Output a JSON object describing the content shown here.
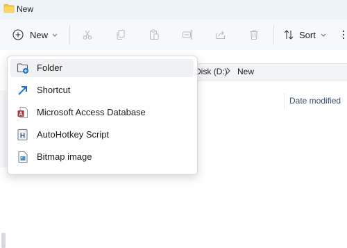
{
  "window": {
    "title": "New"
  },
  "toolbar": {
    "new_label": "New",
    "sort_label": "Sort",
    "icons": [
      "plus-circle-icon",
      "cut-icon",
      "copy-icon",
      "paste-icon",
      "rename-icon",
      "share-icon",
      "delete-icon",
      "sort-icon",
      "more-icon"
    ]
  },
  "address": {
    "crumbs": [
      "Disk (D:)",
      "New"
    ],
    "crumb_visible": "Disk (D:)"
  },
  "columns": {
    "date_modified": "Date modified"
  },
  "menu": {
    "items": [
      {
        "label": "Folder",
        "icon": "new-folder-icon",
        "selected": true
      },
      {
        "label": "Shortcut",
        "icon": "shortcut-icon",
        "selected": false
      },
      {
        "label": "Microsoft Access Database",
        "icon": "access-icon",
        "selected": false
      },
      {
        "label": "AutoHotkey Script",
        "icon": "autohotkey-icon",
        "selected": false
      },
      {
        "label": "Bitmap image",
        "icon": "bitmap-icon",
        "selected": false
      }
    ]
  },
  "colors": {
    "accent": "#1a73c8",
    "access_red": "#a4373a",
    "folder_yellow": "#f7c84a"
  }
}
